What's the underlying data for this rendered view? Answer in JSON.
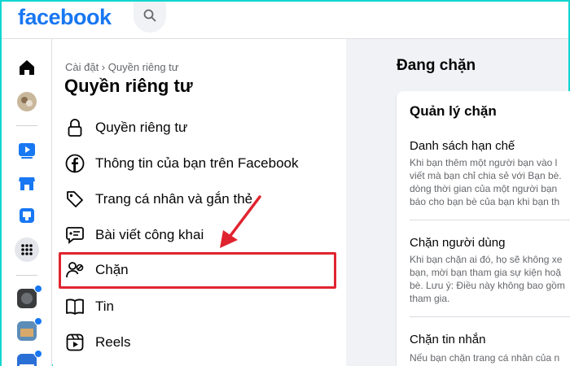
{
  "header": {
    "logo": "facebook",
    "search_icon": "search-icon"
  },
  "left_rail": {
    "items": [
      "home-icon",
      "profile-avatar",
      "watch-icon",
      "marketplace-icon",
      "gaming-icon",
      "menu-grid-icon",
      "group-avatar",
      "group-avatar",
      "group-avatar"
    ]
  },
  "settings": {
    "breadcrumb": "Cài đặt › Quyền riêng tư",
    "title": "Quyền riêng tư",
    "items": [
      {
        "label": "Quyền riêng tư",
        "icon": "lock-icon"
      },
      {
        "label": "Thông tin của bạn trên Facebook",
        "icon": "facebook-icon"
      },
      {
        "label": "Trang cá nhân và gắn thẻ",
        "icon": "tag-icon"
      },
      {
        "label": "Bài viết công khai",
        "icon": "public-post-icon"
      },
      {
        "label": "Chặn",
        "icon": "block-user-icon"
      },
      {
        "label": "Tin",
        "icon": "story-icon"
      },
      {
        "label": "Reels",
        "icon": "reels-icon"
      }
    ],
    "highlight_color": "#e0242f"
  },
  "blocking": {
    "title": "Đang chặn",
    "card_title": "Quản lý chặn",
    "sections": [
      {
        "title": "Danh sách hạn chế",
        "desc": [
          "Khi bạn thêm một người bạn vào l",
          "viết mà bạn chỉ chia sẻ với Bạn bè.",
          "dòng thời gian của một người bạn",
          "báo cho bạn bè của bạn khi bạn th"
        ]
      },
      {
        "title": "Chặn người dùng",
        "desc": [
          "Khi bạn chặn ai đó, họ sẽ không xe",
          "bạn, mời bạn tham gia sự kiện hoặ",
          "bè. Lưu ý: Điều này không bao gồm",
          "tham gia."
        ]
      },
      {
        "title": "Chặn tin nhắn",
        "desc": [
          "Nếu bạn chặn trang cá nhân của n"
        ]
      }
    ]
  },
  "colors": {
    "brand": "#1877f2",
    "frame": "#10d6cf",
    "arrow": "#e0242f"
  }
}
